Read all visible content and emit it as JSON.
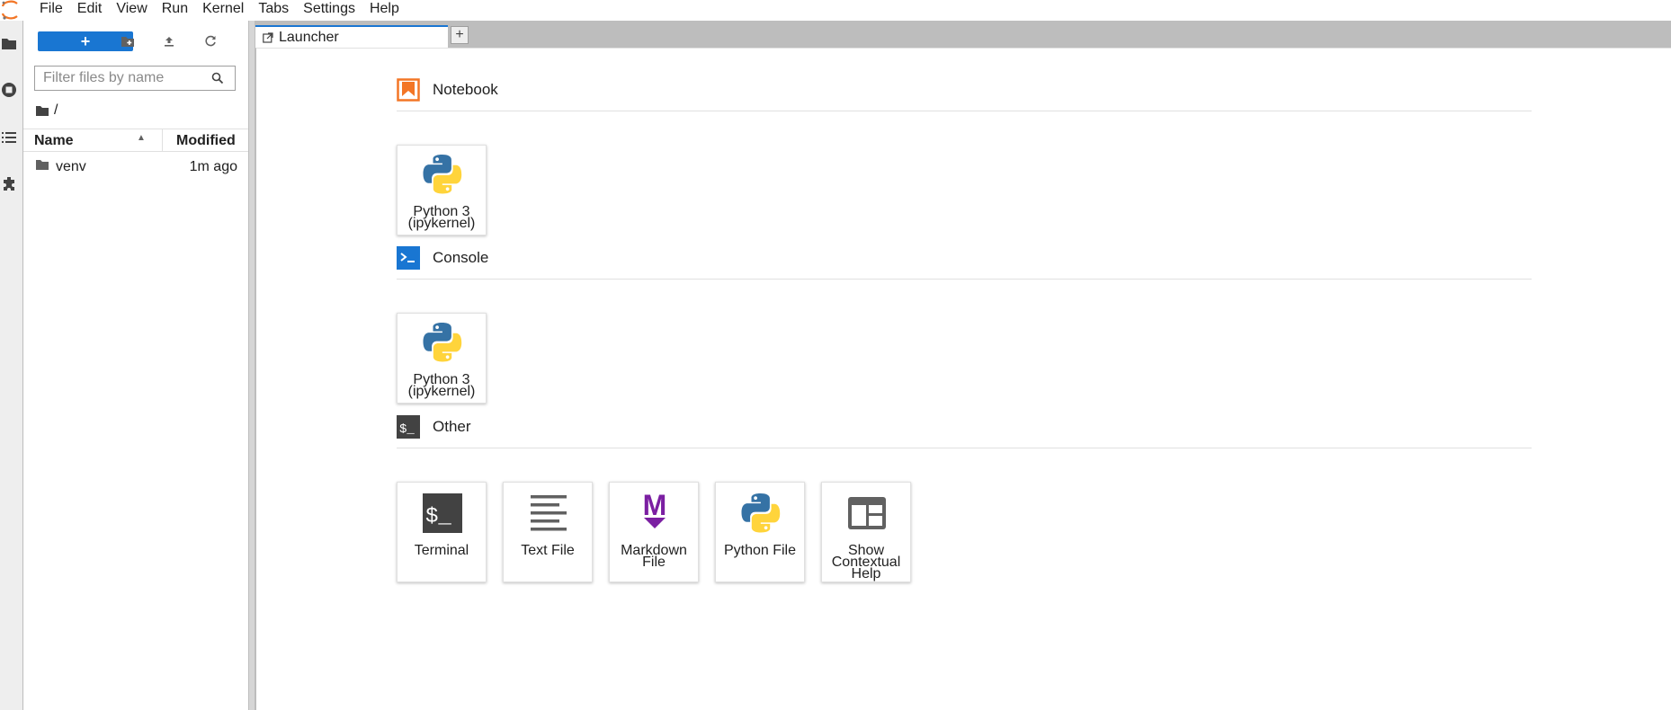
{
  "menubar": {
    "items": [
      "File",
      "Edit",
      "View",
      "Run",
      "Kernel",
      "Tabs",
      "Settings",
      "Help"
    ]
  },
  "sidebar_icons": [
    "folder-icon",
    "running-icon",
    "toc-icon",
    "extension-icon"
  ],
  "filebrowser": {
    "new_label": "+",
    "filter_placeholder": "Filter files by name",
    "breadcrumb": "/",
    "columns": {
      "name": "Name",
      "modified": "Modified"
    },
    "files": [
      {
        "name": "venv",
        "modified": "1m ago",
        "type": "folder"
      }
    ]
  },
  "tabs": {
    "active": "Launcher",
    "add_label": "+"
  },
  "launcher": {
    "sections": [
      {
        "title": "Notebook",
        "cards": [
          {
            "label_line1": "Python 3",
            "label_line2": "(ipykernel)",
            "icon": "python-icon"
          }
        ]
      },
      {
        "title": "Console",
        "cards": [
          {
            "label_line1": "Python 3",
            "label_line2": "(ipykernel)",
            "icon": "python-icon"
          }
        ]
      },
      {
        "title": "Other",
        "cards": [
          {
            "label_line1": "Terminal",
            "label_line2": "",
            "icon": "terminal-icon"
          },
          {
            "label_line1": "Text File",
            "label_line2": "",
            "icon": "text-file-icon"
          },
          {
            "label_line1": "Markdown",
            "label_line2": "File",
            "icon": "markdown-icon"
          },
          {
            "label_line1": "Python File",
            "label_line2": "",
            "icon": "python-icon"
          },
          {
            "label_line1": "Show",
            "label_line2": "Contextual",
            "label_line3": "Help",
            "icon": "contextual-help-icon"
          }
        ]
      }
    ]
  },
  "colors": {
    "accent": "#1976d2",
    "notebook_orange": "#f37626",
    "console_blue": "#1976d2",
    "markdown_purple": "#7b1fa2",
    "python_blue": "#3572a5",
    "python_yellow": "#ffd43b"
  }
}
